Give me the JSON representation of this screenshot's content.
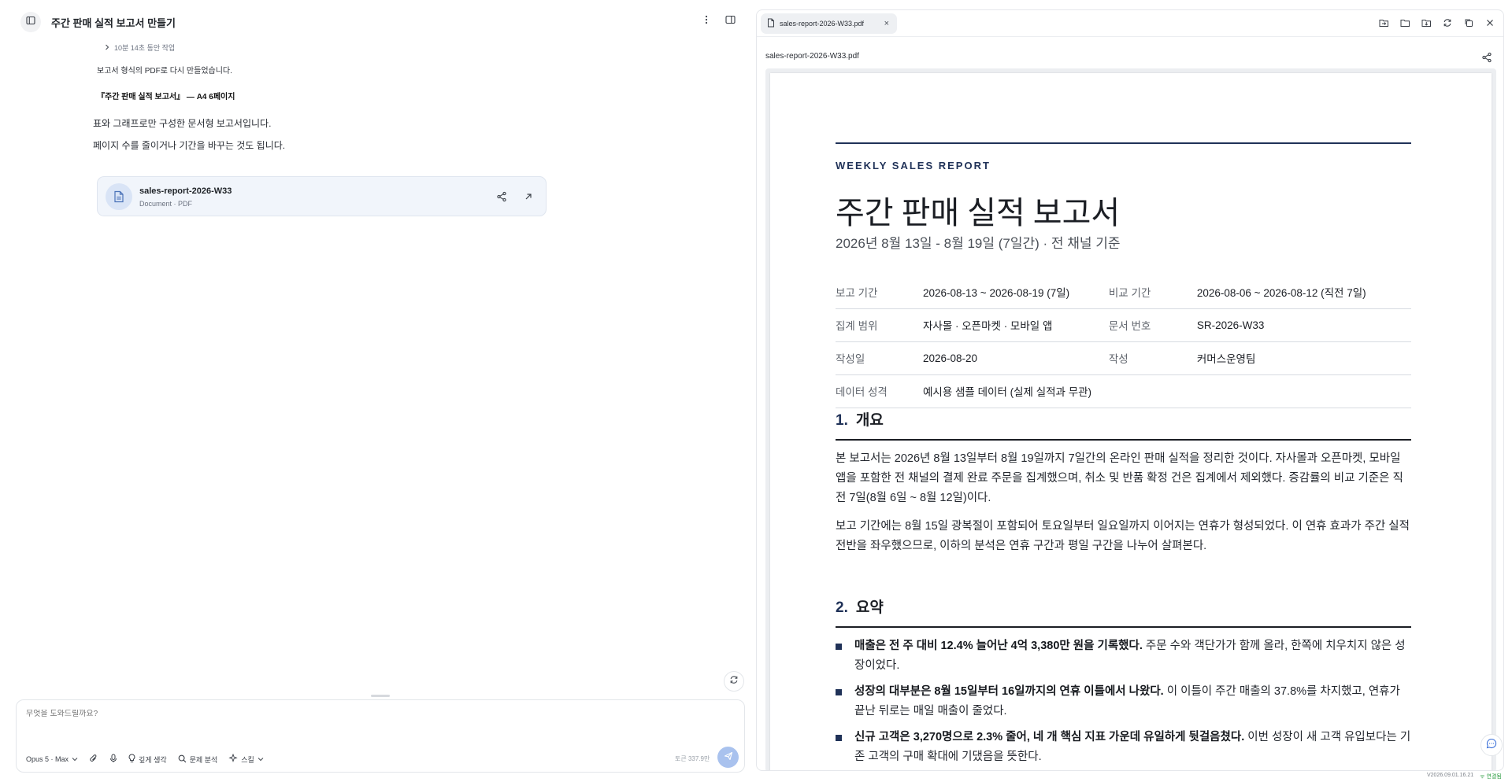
{
  "left": {
    "title": "주간 판매 실적 보고서 만들기",
    "worked_label": "10분 14초 동안 작업",
    "messages": [
      "보고서 형식의 PDF로 다시 만들었습니다.",
      "『주간 판매 실적 보고서』 — A4 6페이지",
      "표와 그래프로만 구성한 문서형 보고서입니다.",
      "페이지 수를 줄이거나 기간을 바꾸는 것도 됩니다."
    ],
    "file_card": {
      "name": "sales-report-2026-W33",
      "meta": "Document · PDF"
    }
  },
  "composer": {
    "placeholder": "무엇을 도와드릴까요?",
    "model": "Opus 5 · Max",
    "tools": [
      "깊게 생각",
      "문제 분석",
      "스킬"
    ],
    "tokens": "토큰 337.9만"
  },
  "right": {
    "tab_label": "sales-report-2026-W33.pdf",
    "filename": "sales-report-2026-W33.pdf"
  },
  "report": {
    "kicker": "WEEKLY SALES REPORT",
    "title": "주간 판매 실적 보고서",
    "subtitle": "2026년 8월 13일  -  8월 19일 (7일간) · 전 채널 기준",
    "meta": [
      {
        "k1": "보고 기간",
        "v1": "2026-08-13 ~ 2026-08-19 (7일)",
        "k2": "비교 기간",
        "v2": "2026-08-06 ~ 2026-08-12 (직전 7일)"
      },
      {
        "k1": "집계 범위",
        "v1": "자사몰 · 오픈마켓 · 모바일 앱",
        "k2": "문서 번호",
        "v2": "SR-2026-W33"
      },
      {
        "k1": "작성일",
        "v1": "2026-08-20",
        "k2": "작성",
        "v2": "커머스운영팀"
      },
      {
        "k1": "데이터 성격",
        "v1": "예시용 샘플 데이터 (실제 실적과 무관)",
        "k2": "",
        "v2": ""
      }
    ],
    "sections": [
      {
        "num": "1.",
        "title": "개요"
      },
      {
        "num": "2.",
        "title": "요약"
      }
    ],
    "overview": [
      "본 보고서는 2026년 8월 13일부터 8월 19일까지 7일간의 온라인 판매 실적을 정리한 것이다. 자사몰과 오픈마켓, 모바일 앱을 포함한 전 채널의 결제 완료 주문을 집계했으며, 취소 및 반품 확정 건은 집계에서 제외했다. 증감률의 비교 기준은 직전 7일(8월 6일 ~ 8월 12일)이다.",
      "보고 기간에는 8월 15일 광복절이 포함되어 토요일부터 일요일까지 이어지는 연휴가 형성되었다. 이 연휴 효과가 주간 실적 전반을 좌우했으므로, 이하의 분석은 연휴 구간과 평일 구간을 나누어 살펴본다."
    ],
    "summary": [
      {
        "bold": "매출은 전 주 대비 12.4% 늘어난 4억 3,380만 원을 기록했다.",
        "rest": " 주문 수와 객단가가 함께 올라, 한쪽에 치우치지 않은 성장이었다."
      },
      {
        "bold": "성장의 대부분은 8월 15일부터 16일까지의 연휴 이틀에서 나왔다.",
        "rest": " 이 이틀이 주간 매출의 37.8%를 차지했고, 연휴가 끝난 뒤로는 매일 매출이 줄었다."
      },
      {
        "bold": "신규 고객은 3,270명으로 2.3% 줄어, 네 개 핵심 지표 가운데 유일하게 뒷걸음쳤다.",
        "rest": " 이번 성장이 새 고객 유입보다는 기존 고객의 구매 확대에 기댔음을 뜻한다."
      }
    ]
  },
  "footer": {
    "version": "V2026.09.01.16.21",
    "status": "연결됨"
  }
}
